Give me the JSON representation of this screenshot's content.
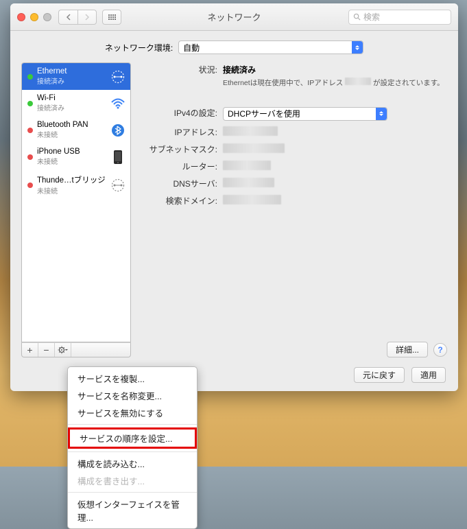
{
  "window": {
    "title": "ネットワーク"
  },
  "search": {
    "placeholder": "検索"
  },
  "location": {
    "label": "ネットワーク環境:",
    "value": "自動"
  },
  "services": [
    {
      "name": "Ethernet",
      "status": "接続済み",
      "dot": "green",
      "selected": true,
      "icon": "ethernet"
    },
    {
      "name": "Wi-Fi",
      "status": "接続済み",
      "dot": "green",
      "selected": false,
      "icon": "wifi"
    },
    {
      "name": "Bluetooth PAN",
      "status": "未接続",
      "dot": "red",
      "selected": false,
      "icon": "bluetooth"
    },
    {
      "name": "iPhone USB",
      "status": "未接続",
      "dot": "red",
      "selected": false,
      "icon": "iphone"
    },
    {
      "name": "Thunde…tブリッジ",
      "status": "未接続",
      "dot": "red",
      "selected": false,
      "icon": "thunderbolt"
    }
  ],
  "detail": {
    "state_label": "状況:",
    "state_value": "接続済み",
    "state_desc_pre": "Ethernetは現在使用中で、IPアドレス",
    "state_desc_post": "が設定されています。",
    "ipv4_label": "IPv4の設定:",
    "ipv4_value": "DHCPサーバを使用",
    "ip_label": "IPアドレス:",
    "subnet_label": "サブネットマスク:",
    "router_label": "ルーター:",
    "dns_label": "DNSサーバ:",
    "domain_label": "検索ドメイン:"
  },
  "buttons": {
    "advanced": "詳細...",
    "revert": "元に戻す",
    "apply": "適用"
  },
  "gearmenu": [
    {
      "label": "サービスを複製...",
      "enabled": true
    },
    {
      "label": "サービスを名称変更...",
      "enabled": true
    },
    {
      "label": "サービスを無効にする",
      "enabled": true
    },
    {
      "sep": true
    },
    {
      "label": "サービスの順序を設定...",
      "enabled": true,
      "highlight": true
    },
    {
      "sep": true
    },
    {
      "label": "構成を読み込む...",
      "enabled": true
    },
    {
      "label": "構成を書き出す...",
      "enabled": false
    },
    {
      "sep": true
    },
    {
      "label": "仮想インターフェイスを管理...",
      "enabled": true
    }
  ]
}
